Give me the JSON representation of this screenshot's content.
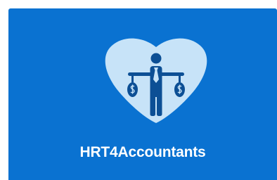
{
  "tile": {
    "title": "HRT4Accountants",
    "background": "#0a72d1",
    "icon": "accountant-balance-scale-icon",
    "icon_color": "#0c4f95",
    "badge_color": "#c7e3f8"
  }
}
